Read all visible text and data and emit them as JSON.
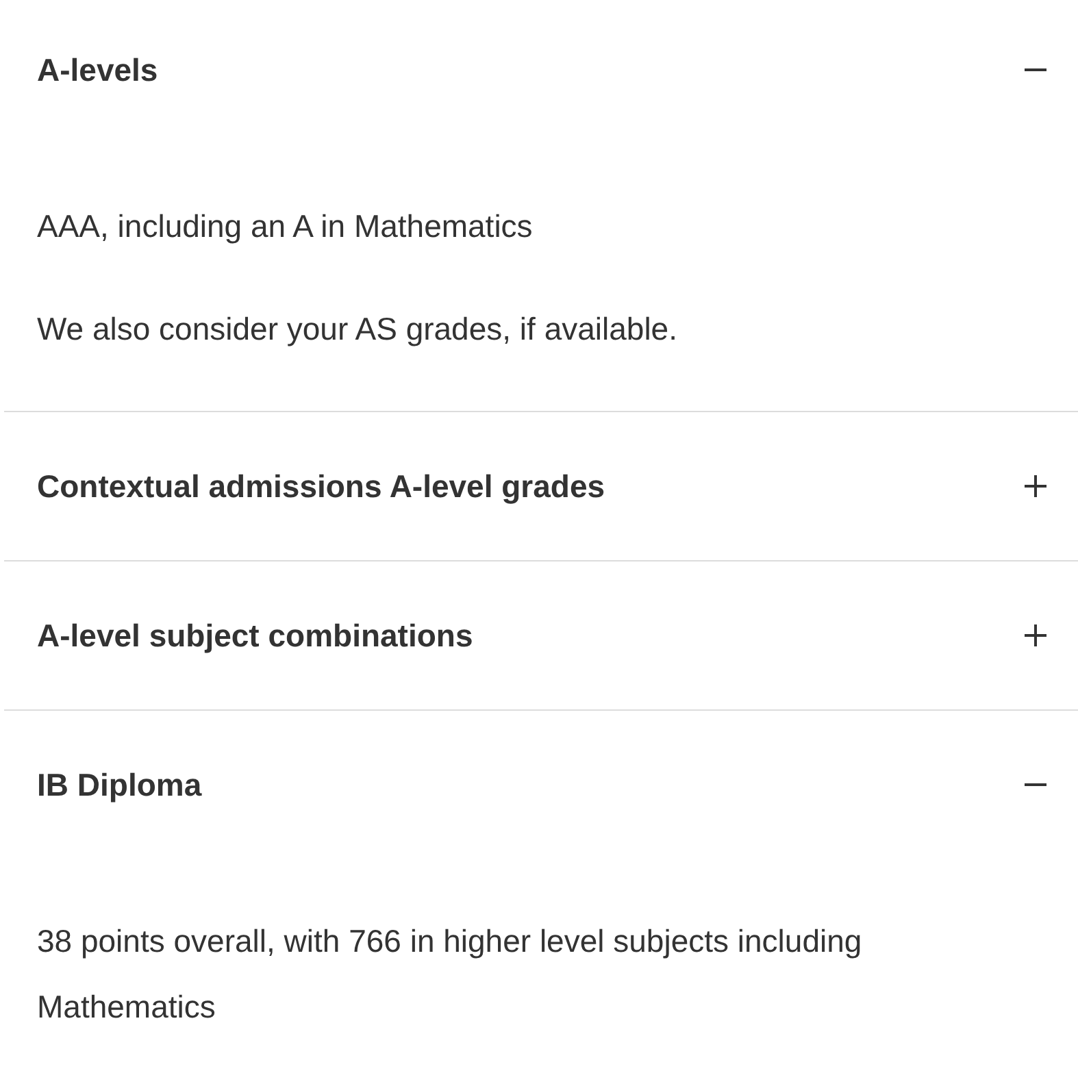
{
  "sections": [
    {
      "title": "A-levels",
      "expanded": true,
      "paragraphs": [
        "AAA, including an A in Mathematics",
        "We also consider your AS grades, if available."
      ]
    },
    {
      "title": "Contextual admissions A-level grades",
      "expanded": false
    },
    {
      "title": "A-level subject combinations",
      "expanded": false
    },
    {
      "title": "IB Diploma",
      "expanded": true,
      "paragraphs": [
        "38 points overall, with 766 in higher level subjects including Mathematics"
      ]
    }
  ]
}
